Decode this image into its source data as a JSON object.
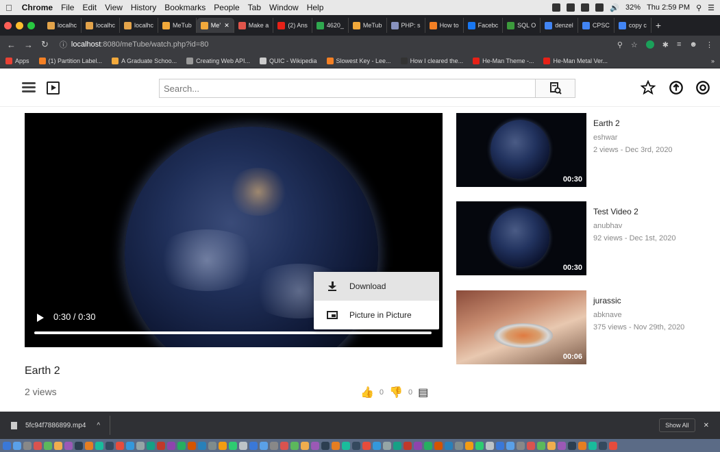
{
  "menubar": {
    "apple_icon": "apple-icon",
    "items": [
      "Chrome",
      "File",
      "Edit",
      "View",
      "History",
      "Bookmarks",
      "People",
      "Tab",
      "Window",
      "Help"
    ],
    "battery": "32%",
    "clock": "Thu 2:59 PM"
  },
  "tabs": [
    {
      "label": "localhc",
      "color": "#e3a34a"
    },
    {
      "label": "localhc",
      "color": "#e3a34a"
    },
    {
      "label": "localhc",
      "color": "#e3a34a"
    },
    {
      "label": "MeTub",
      "color": "#f2a93b"
    },
    {
      "label": "Me’",
      "color": "#f2a93b",
      "active": true
    },
    {
      "label": "Make a",
      "color": "#e0554b"
    },
    {
      "label": "(2) Ans",
      "color": "#e62117"
    },
    {
      "label": "4620_",
      "color": "#2fa84f"
    },
    {
      "label": "MeTub",
      "color": "#f2a93b"
    },
    {
      "label": "PHP: s",
      "color": "#8892bf"
    },
    {
      "label": "How to",
      "color": "#f48024"
    },
    {
      "label": "Facebc",
      "color": "#1877f2"
    },
    {
      "label": "SQL O",
      "color": "#3c9a3c"
    },
    {
      "label": "denzel",
      "color": "#4285f4"
    },
    {
      "label": "CPSC",
      "color": "#4285f4"
    },
    {
      "label": "copy c",
      "color": "#4285f4"
    }
  ],
  "address": {
    "url_host": "localhost",
    "url_path": ":8080/meTube/watch.php?id=80"
  },
  "bookmarks": [
    {
      "label": "Apps",
      "color": "#e94235"
    },
    {
      "label": "(1) Partition Label...",
      "color": "#f48024"
    },
    {
      "label": "A Graduate Schoo...",
      "color": "#f2a93b"
    },
    {
      "label": "Creating Web API...",
      "color": "#999999"
    },
    {
      "label": "QUIC - Wikipedia",
      "color": "#cccccc"
    },
    {
      "label": "Slowest Key - Lee...",
      "color": "#f48024"
    },
    {
      "label": "How I cleared the...",
      "color": "#333333"
    },
    {
      "label": "He-Man Theme -...",
      "color": "#e62117"
    },
    {
      "label": "He-Man Metal Ver...",
      "color": "#e62117"
    }
  ],
  "bookmarks_more": "»",
  "header": {
    "search_placeholder": "Search..."
  },
  "player": {
    "time": "0:30 / 0:30",
    "progress": 1.0
  },
  "context_menu": {
    "items": [
      "Download",
      "Picture in Picture"
    ]
  },
  "video": {
    "title": "Earth 2",
    "views": "2 views",
    "likes": "0",
    "dislikes": "0"
  },
  "recommendations": [
    {
      "title": "Earth 2",
      "channel": "eshwar",
      "meta": "2 views - Dec 3rd, 2020",
      "duration": "00:30",
      "thumb": "earth"
    },
    {
      "title": "Test Video 2",
      "channel": "anubhav",
      "meta": "92 views - Dec 1st, 2020",
      "duration": "00:30",
      "thumb": "earth"
    },
    {
      "title": "jurassic",
      "channel": "abknave",
      "meta": "375 views - Nov 29th, 2020",
      "duration": "00:06",
      "thumb": "food"
    }
  ],
  "downloads": {
    "file": "5fc94f7886899.mp4",
    "show_all": "Show All",
    "close": "✕"
  }
}
